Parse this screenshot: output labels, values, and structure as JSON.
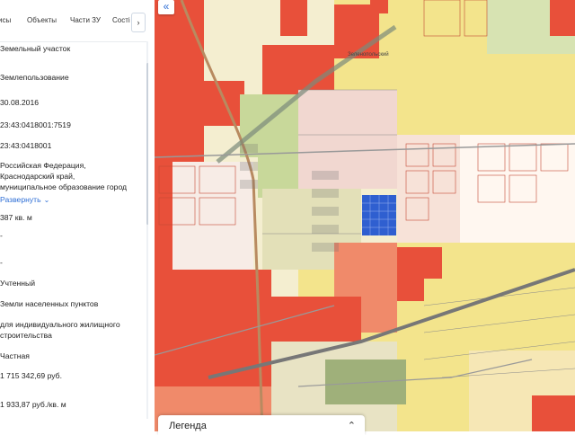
{
  "tabs": [
    "исы",
    "Объекты",
    "Части ЗУ",
    "Сості"
  ],
  "tab_scroll_icon": "chevron-right-icon",
  "fields": {
    "object_type": "Земельный участок",
    "subtype": "Землепользование",
    "date": "30.08.2016",
    "cadastral_number": "23:43:0418001:7519",
    "quarter": "23:43:0418001",
    "address_line1": "Российская Федерация,",
    "address_line2": "Краснодарский край,",
    "address_line3": "муниципальное образование город",
    "expand_label": "Развернуть",
    "area": "387 кв. м",
    "dash1": "-",
    "dash2": "-",
    "status": "Учтенный",
    "category": "Земли населенных пунктов",
    "use_line1": "для индивидуального жилищного",
    "use_line2": "строительства",
    "ownership": "Частная",
    "cadastral_value": "1 715 342,69 руб.",
    "specific_value": "1 933,87 руб./кв. м"
  },
  "map": {
    "collapse_icon": "double-chevron-left-icon",
    "legend_label": "Легенда",
    "legend_icon": "updown-chevron-icon",
    "place_labels": [
      "Зеленопольский"
    ],
    "colors": {
      "parcel_red": "#e8503a",
      "residential_yellow": "#f5e8a0",
      "field_green": "#c8d89a",
      "selected_blue": "#2f5fd0",
      "road_gray": "#9a9a9a",
      "pink_zone": "#f1d7d0"
    }
  }
}
